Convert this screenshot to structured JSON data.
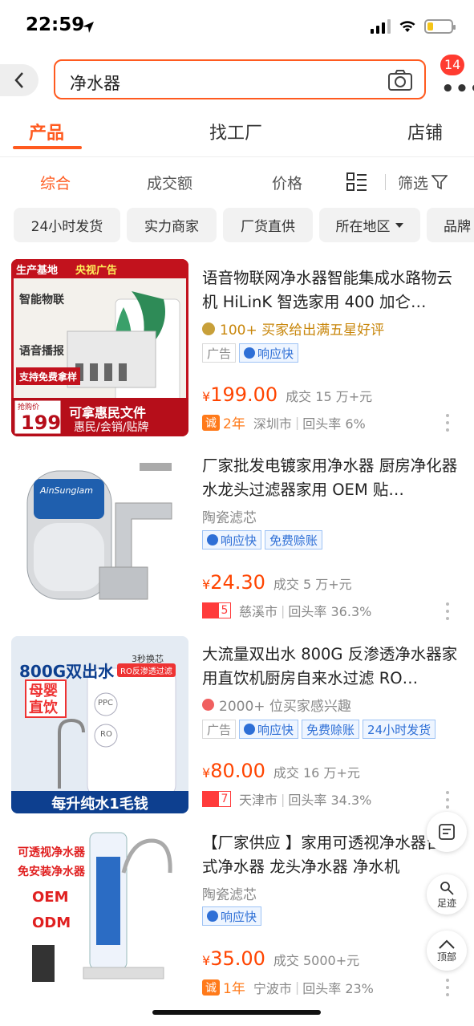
{
  "status_bar": {
    "time": "22:59"
  },
  "search": {
    "query": "净水器",
    "badge_count": "14"
  },
  "tabs": [
    {
      "label": "产品",
      "active": true
    },
    {
      "label": "找工厂",
      "active": false
    },
    {
      "label": "店铺",
      "active": false
    }
  ],
  "sort": [
    {
      "label": "综合",
      "active": true
    },
    {
      "label": "成交额"
    },
    {
      "label": "价格"
    },
    {
      "label": "筛选"
    }
  ],
  "filters": [
    "24小时发货",
    "实力商家",
    "厂货直供",
    "所在地区",
    "品牌"
  ],
  "products": [
    {
      "title": "语音物联网净水器智能集成水路物云机 HiLinK 智选家用 400 加仑…",
      "subtitle": "100+ 买家给出满五星好评",
      "tags": [
        "广告",
        "响应快"
      ],
      "price": "199.00",
      "currency": "¥",
      "sales": "成交 15 万+元",
      "badge_type": "cheng",
      "badge_text": "2年",
      "location": "深圳市",
      "repurchase": "回头率 6%",
      "image_texts": {
        "banner_left": "生产基地",
        "banner_right": "央视广告",
        "line1": "智能物联",
        "line2": "语音播报",
        "cta": "支持免费拿样",
        "price_tag": "199",
        "price_tag_label": "抢购价",
        "bottom1": "可拿惠民文件",
        "bottom2": "惠民/会销/贴牌"
      }
    },
    {
      "title": "厂家批发电镀家用净水器 厨房净化器水龙头过滤器家用 OEM 贴…",
      "subtitle": "陶瓷滤芯",
      "tags": [
        "响应快",
        "免费赊账"
      ],
      "price": "24.30",
      "currency": "¥",
      "sales": "成交 5 万+元",
      "badge_type": "level",
      "badge_text": "5",
      "location": "慈溪市",
      "repurchase": "回头率 36.3%",
      "image_texts": {
        "brand": "AinSunglam"
      }
    },
    {
      "title": "大流量双出水 800G 反渗透净水器家用直饮机厨房自来水过滤 RO…",
      "subtitle": "2000+ 位买家感兴趣",
      "tags": [
        "广告",
        "响应快",
        "免费赊账",
        "24小时发货"
      ],
      "price": "80.00",
      "currency": "¥",
      "sales": "成交 16 万+元",
      "badge_type": "level",
      "badge_text": "7",
      "location": "天津市",
      "repurchase": "回头率 34.3%",
      "image_texts": {
        "headline": "800G双出水",
        "corner": "3秒换芯",
        "ro": "RO反渗透过滤",
        "mother": "母婴直饮",
        "bottom": "每升纯水1毛钱",
        "ppc": "PPC",
        "ro_label": "RO"
      }
    },
    {
      "title": "【厂家供应 】家用可透视净水器台式净水器 龙头净水器 净水机",
      "subtitle": "陶瓷滤芯",
      "tags": [
        "响应快"
      ],
      "price": "35.00",
      "currency": "¥",
      "sales": "成交 5000+元",
      "badge_type": "cheng",
      "badge_text": "1年",
      "location": "宁波市",
      "repurchase": "回头率 23%",
      "image_texts": {
        "l1": "可透视净水器",
        "l2": "免安装净水器",
        "l3": "OEM",
        "l4": "ODM"
      }
    }
  ],
  "side_buttons": {
    "list": "",
    "footprint": "足迹",
    "top": "顶部"
  },
  "badges": {
    "cheng": "诚"
  },
  "colors": {
    "accent": "#ff5a1f",
    "price": "#ff4400",
    "tag_blue": "#2e6fd6"
  }
}
